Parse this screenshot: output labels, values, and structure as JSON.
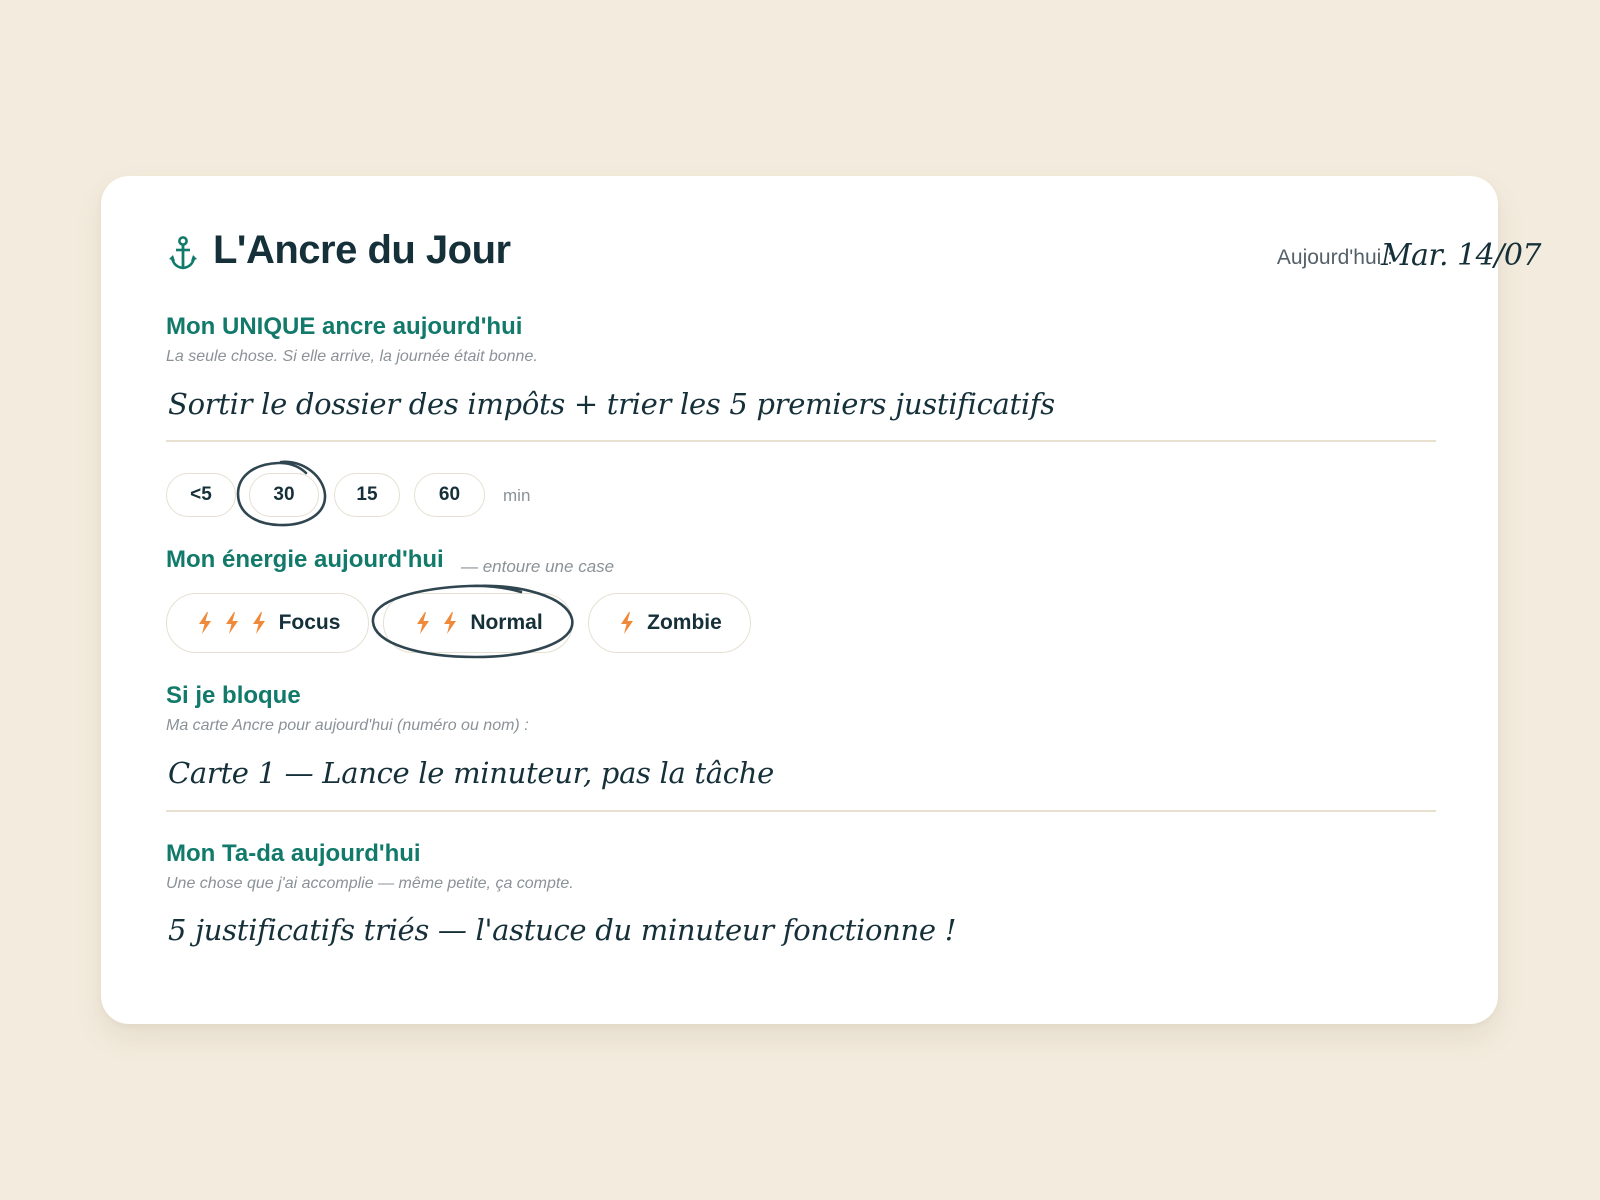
{
  "header": {
    "title": "L'Ancre du Jour",
    "date_label": "Aujourd'hui :",
    "date_value": "Mar. 14/07"
  },
  "anchor": {
    "heading": "Mon UNIQUE ancre aujourd'hui",
    "subtitle": "La seule chose. Si elle arrive, la journée était bonne.",
    "value": "Sortir le dossier des impôts + trier les 5 premiers justificatifs"
  },
  "time": {
    "options": [
      "<5",
      "30",
      "15",
      "60"
    ],
    "selected": "30",
    "unit": "min"
  },
  "energy": {
    "heading": "Mon énergie aujourd'hui",
    "hint": "— entoure une case",
    "options": [
      {
        "label": "Focus",
        "bolts": 3
      },
      {
        "label": "Normal",
        "bolts": 2
      },
      {
        "label": "Zombie",
        "bolts": 1
      }
    ],
    "selected": "Normal"
  },
  "blocked": {
    "heading": "Si je bloque",
    "subtitle": "Ma carte Ancre pour aujourd'hui (numéro ou nom) :",
    "value": "Carte 1 — Lance le minuteur, pas la tâche"
  },
  "tada": {
    "heading": "Mon Ta-da aujourd'hui",
    "subtitle": "Une chose que j'ai accomplie — même petite, ça compte.",
    "value": "5 justificatifs triés — l'astuce du minuteur fonctionne !"
  },
  "colors": {
    "background": "#f3ebdd",
    "accent": "#127a6a",
    "ink": "#16303a",
    "bolt": "#ef8a3a",
    "circle_stroke": "#2f4650"
  }
}
